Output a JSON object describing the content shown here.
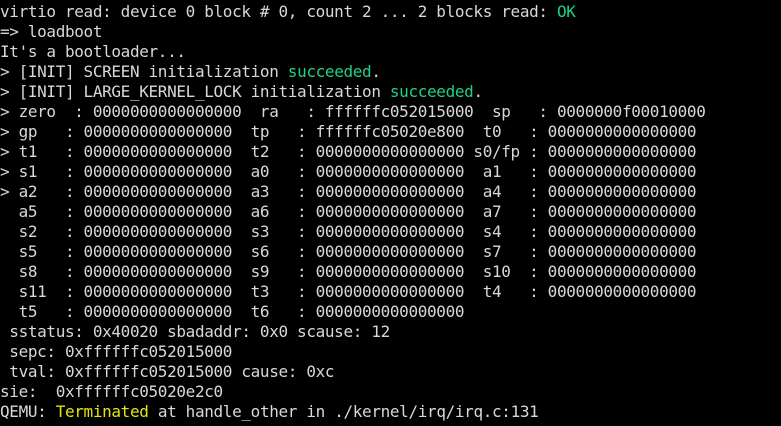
{
  "terminal": {
    "line1": {
      "prefix": "virtio read: device 0 block # 0, count 2 ... 2 blocks read: ",
      "ok": "OK"
    },
    "line2": "=> loadboot",
    "line3": "It's a bootloader...",
    "line4": {
      "prefix": "> [INIT] SCREEN initialization ",
      "status": "succeeded",
      "suffix": "."
    },
    "line5": {
      "prefix": "> [INIT] LARGE_KERNEL_LOCK initialization ",
      "status": "succeeded",
      "suffix": "."
    },
    "registers": [
      "> zero  : 0000000000000000  ra   : ffffffc052015000  sp   : 0000000f00010000",
      "> gp   : 0000000000000000  tp   : ffffffc05020e800  t0   : 0000000000000000",
      "> t1   : 0000000000000000  t2   : 0000000000000000 s0/fp : 0000000000000000",
      "> s1   : 0000000000000000  a0   : 0000000000000000  a1   : 0000000000000000",
      "> a2   : 0000000000000000  a3   : 0000000000000000  a4   : 0000000000000000",
      "  a5   : 0000000000000000  a6   : 0000000000000000  a7   : 0000000000000000",
      "  s2   : 0000000000000000  s3   : 0000000000000000  s4   : 0000000000000000",
      "  s5   : 0000000000000000  s6   : 0000000000000000  s7   : 0000000000000000",
      "  s8   : 0000000000000000  s9   : 0000000000000000  s10  : 0000000000000000",
      "  s11  : 0000000000000000  t3   : 0000000000000000  t4   : 0000000000000000",
      "  t5   : 0000000000000000  t6   : 0000000000000000"
    ],
    "sstatus_line": " sstatus: 0x40020 sbadaddr: 0x0 scause: 12",
    "sepc_line": " sepc: 0xffffffc052015000",
    "tval_line": " tval: 0xffffffc052015000 cause: 0xc",
    "sie_line": "sie:  0xffffffc05020e2c0",
    "qemu_line": {
      "prefix": "QEMU: ",
      "status": "Terminated",
      "suffix": " at handle_other in ./kernel/irq/irq.c:131"
    }
  },
  "colors": {
    "background": "#000000",
    "foreground": "#d8d8d8",
    "success": "#1fd186",
    "warning": "#e5e510"
  }
}
